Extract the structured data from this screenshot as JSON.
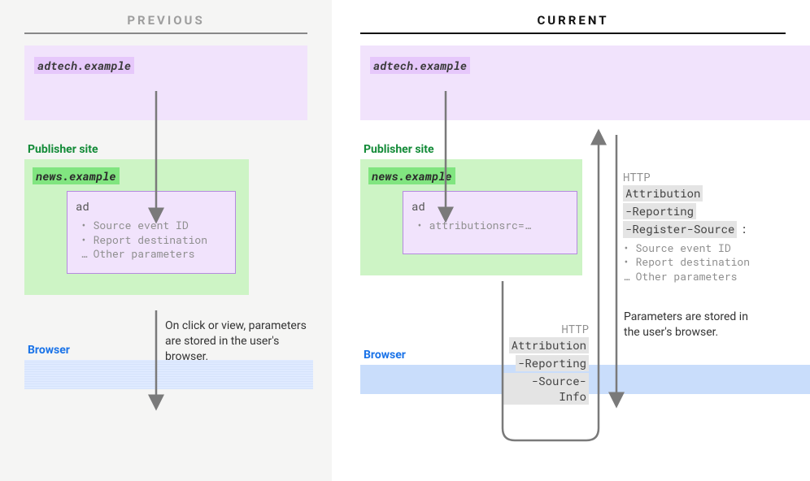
{
  "headers": {
    "previous": "PREVIOUS",
    "current": "CURRENT"
  },
  "adtech": "adtech.example",
  "publisher_label": "Publisher site",
  "news": "news.example",
  "ad_label": "ad",
  "prev": {
    "ad_items": {
      "i1": "• Source event ID",
      "i2": "• Report destination",
      "i3": "… Other parameters"
    },
    "note": "On click or view, parameters are stored in the user's browser."
  },
  "curr": {
    "ad_items": {
      "i1": "• attributionsrc=…"
    },
    "out": {
      "http": "HTTP",
      "h1": "Attribution",
      "h2": "-Reporting",
      "h3": "-Source-Info"
    },
    "in": {
      "http": "HTTP",
      "h1": "Attribution",
      "h2": "-Reporting",
      "h3": "-Register-Source",
      "colon": ":",
      "p1": "• Source event ID",
      "p2": "• Report destination",
      "p3": "… Other parameters"
    },
    "note": "Parameters are stored in the user's browser."
  },
  "browser_label": "Browser"
}
